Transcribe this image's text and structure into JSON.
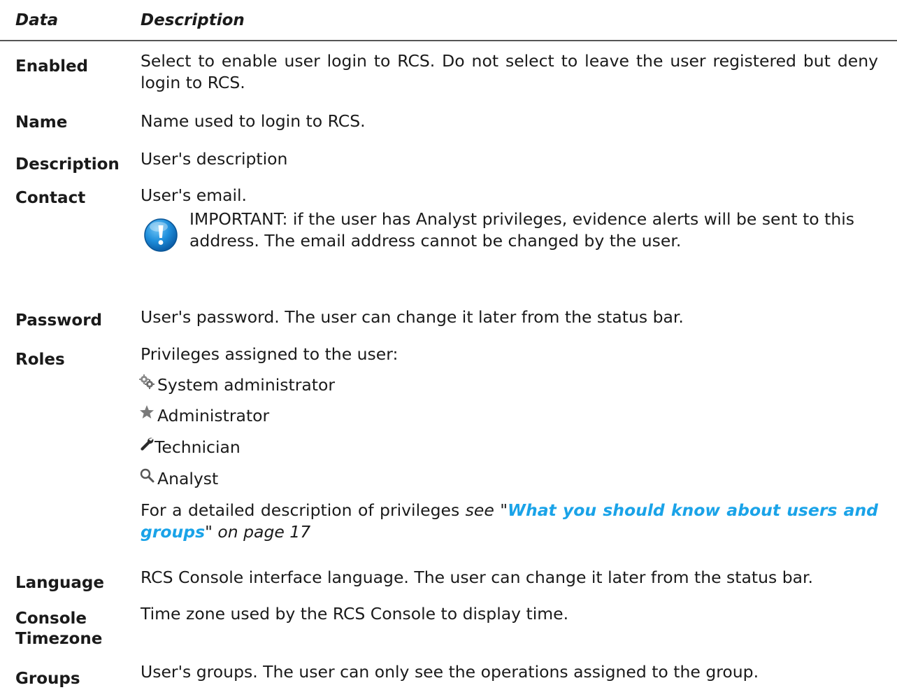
{
  "header": {
    "data": "Data",
    "description": "Description"
  },
  "rows": {
    "enabled": {
      "label": "Enabled",
      "text": "Select to enable user login to RCS. Do not select to leave the user registered but deny login to RCS."
    },
    "name": {
      "label": "Name",
      "text": "Name used to login to RCS."
    },
    "description": {
      "label": "Description",
      "text": "User's description"
    },
    "contact": {
      "label": "Contact",
      "text": "User's email.",
      "note": "IMPORTANT: if the user has Analyst privileges, evidence alerts will be sent to this address. The email address cannot be changed by the user.",
      "note_icon": "important-icon"
    },
    "password": {
      "label": "Password",
      "text": "User's password. The user can change it later from the status bar."
    },
    "roles": {
      "label": "Roles",
      "intro": "Privileges assigned to the user:",
      "items": [
        {
          "label": "System administrator",
          "icon": "gears-icon"
        },
        {
          "label": "Administrator",
          "icon": "star-icon"
        },
        {
          "label": "Technician",
          "icon": "wrench-icon"
        },
        {
          "label": "Analyst",
          "icon": "magnifier-icon"
        }
      ],
      "see_prefix": "For a detailed description of privileges ",
      "see_word": "see \"",
      "link_text": "What you should know about users and groups",
      "see_suffix": "\" on page 17"
    },
    "language": {
      "label": "Language",
      "text": "RCS Console interface language. The user can change it later from the status bar."
    },
    "timezone": {
      "label1": "Console",
      "label2": "Timezone",
      "text": "Time zone used by the RCS Console to display time."
    },
    "groups": {
      "label": "Groups",
      "text": "User's groups. The user can only see the operations assigned to the group."
    }
  },
  "colors": {
    "link": "#1aa3e8",
    "important_icon": "#1a86d0"
  }
}
